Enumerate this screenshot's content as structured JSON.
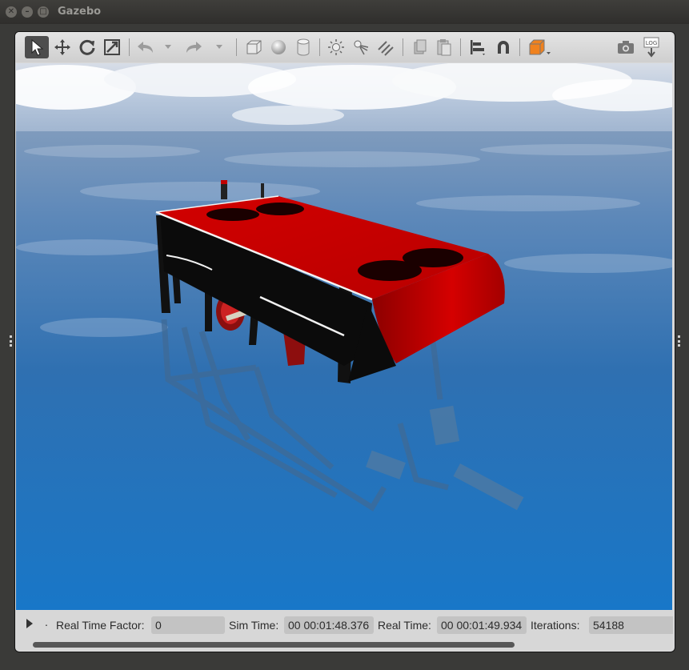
{
  "window": {
    "title": "Gazebo",
    "controls": [
      "close-icon",
      "minimize-icon",
      "maximize-icon"
    ]
  },
  "toolbar": {
    "tools": [
      {
        "name": "select-mode",
        "icon": "arrow-cursor-icon",
        "active": true
      },
      {
        "name": "translate-mode",
        "icon": "move-arrows-icon"
      },
      {
        "name": "rotate-mode",
        "icon": "rotate-icon"
      },
      {
        "name": "scale-mode",
        "icon": "scale-icon"
      },
      {
        "name": "undo",
        "icon": "undo-icon"
      },
      {
        "name": "undo-history",
        "icon": "chevron-down-icon"
      },
      {
        "name": "redo",
        "icon": "redo-icon"
      },
      {
        "name": "redo-history",
        "icon": "chevron-down-icon"
      },
      {
        "name": "box-shape",
        "icon": "box-icon"
      },
      {
        "name": "sphere-shape",
        "icon": "sphere-icon"
      },
      {
        "name": "cylinder-shape",
        "icon": "cylinder-icon"
      },
      {
        "name": "point-light",
        "icon": "sun-icon"
      },
      {
        "name": "spot-light",
        "icon": "spotlight-icon"
      },
      {
        "name": "directional-light",
        "icon": "directional-light-icon"
      },
      {
        "name": "copy",
        "icon": "copy-icon"
      },
      {
        "name": "paste",
        "icon": "paste-icon"
      },
      {
        "name": "align",
        "icon": "align-icon"
      },
      {
        "name": "snap",
        "icon": "magnet-icon"
      },
      {
        "name": "view-angle",
        "icon": "view-cube-icon"
      },
      {
        "name": "screenshot",
        "icon": "camera-icon"
      },
      {
        "name": "log",
        "icon": "log-icon",
        "label": "LOG"
      }
    ],
    "accent_color": "#f0821e"
  },
  "scene": {
    "sky_color": "#b9cbe0",
    "water_color": "#1d74bd",
    "vehicle_color": "#c00000"
  },
  "status": {
    "play_icon": "play-icon",
    "dot": ".",
    "real_time_factor_label": "Real Time Factor:",
    "real_time_factor": "0",
    "sim_time_label": "Sim Time:",
    "sim_time": "00 00:01:48.376",
    "real_time_label": "Real Time:",
    "real_time": "00 00:01:49.934",
    "iterations_label": "Iterations:",
    "iterations": "54188"
  }
}
